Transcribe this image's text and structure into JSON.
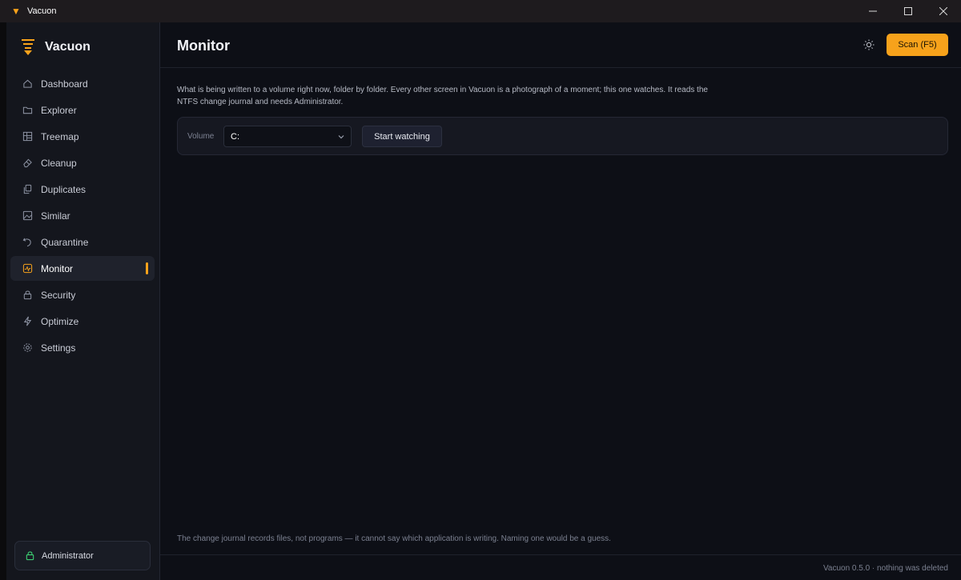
{
  "window": {
    "title": "Vacuon",
    "controls": [
      "minimize",
      "maximize",
      "close"
    ]
  },
  "sidebar": {
    "brand": "Vacuon",
    "items": [
      {
        "label": "Dashboard",
        "icon": "home-icon"
      },
      {
        "label": "Explorer",
        "icon": "folder-icon"
      },
      {
        "label": "Treemap",
        "icon": "grid-icon"
      },
      {
        "label": "Cleanup",
        "icon": "eraser-icon"
      },
      {
        "label": "Duplicates",
        "icon": "copy-icon"
      },
      {
        "label": "Similar",
        "icon": "image-icon"
      },
      {
        "label": "Quarantine",
        "icon": "undo-icon"
      },
      {
        "label": "Monitor",
        "icon": "activity-icon",
        "active": true
      },
      {
        "label": "Security",
        "icon": "lock-icon"
      },
      {
        "label": "Optimize",
        "icon": "bolt-icon"
      },
      {
        "label": "Settings",
        "icon": "gear-icon"
      }
    ],
    "admin_label": "Administrator"
  },
  "header": {
    "title": "Monitor",
    "scan_label": "Scan  (F5)"
  },
  "main": {
    "description": "What is being written to a volume right now, folder by folder. Every other screen in Vacuon is a photograph of a moment; this one watches. It reads the NTFS change journal and needs Administrator.",
    "volume_label": "Volume",
    "volume_value": "C:",
    "start_label": "Start watching",
    "footnote": "The change journal records files, not programs — it cannot say which application is writing. Naming one would be a guess."
  },
  "status": {
    "text": "Vacuon 0.5.0 · nothing was deleted"
  },
  "colors": {
    "accent": "#f7a21b",
    "background": "#0d0f16",
    "sidebar": "#14161d",
    "admin_lock": "#3ccf72"
  }
}
